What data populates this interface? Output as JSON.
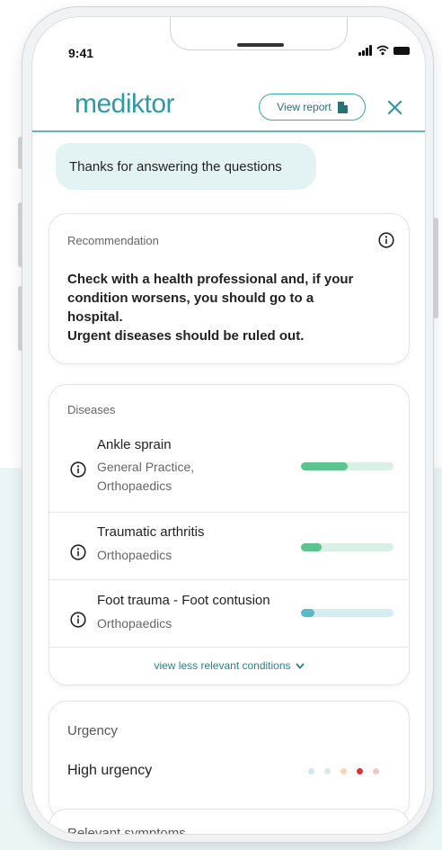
{
  "status_bar": {
    "time": "9:41"
  },
  "header": {
    "logo": "mediktor",
    "view_report_label": "View report",
    "close_icon": "close-icon"
  },
  "chat": {
    "message": "Thanks for answering the questions"
  },
  "recommendation": {
    "label": "Recommendation",
    "lines": [
      "Check with a health professional and, if your",
      "condition worsens, you should go to a",
      "hospital.",
      "Urgent diseases should be ruled out."
    ]
  },
  "diseases": {
    "label": "Diseases",
    "items": [
      {
        "name": "Ankle sprain",
        "specialty_lines": [
          "General Practice,",
          "Orthopaedics"
        ],
        "relevance": 0.5,
        "bar_color": "#5cc48e",
        "track_color": "#d9f1e4"
      },
      {
        "name": "Traumatic arthritis",
        "specialty_lines": [
          "Orthopaedics"
        ],
        "relevance": 0.22,
        "bar_color": "#5cc48e",
        "track_color": "#d9f1e4"
      },
      {
        "name": "Foot trauma - Foot contusion",
        "specialty_lines": [
          "Orthopaedics"
        ],
        "relevance": 0.15,
        "bar_color": "#5ab9c7",
        "track_color": "#d3edf1"
      }
    ],
    "view_less": "view less relevant conditions"
  },
  "urgency": {
    "label": "Urgency",
    "value": "High urgency",
    "dots": [
      {
        "color": "#cfe6ee"
      },
      {
        "color": "#d9eedf"
      },
      {
        "color": "#f7d6b8"
      },
      {
        "color": "#d8323a"
      },
      {
        "color": "#efc8cc"
      }
    ]
  },
  "symptoms": {
    "label": "Relevant symptoms"
  },
  "colors": {
    "accent": "#2a9ca2",
    "background_panel": "#eaf5f5"
  }
}
